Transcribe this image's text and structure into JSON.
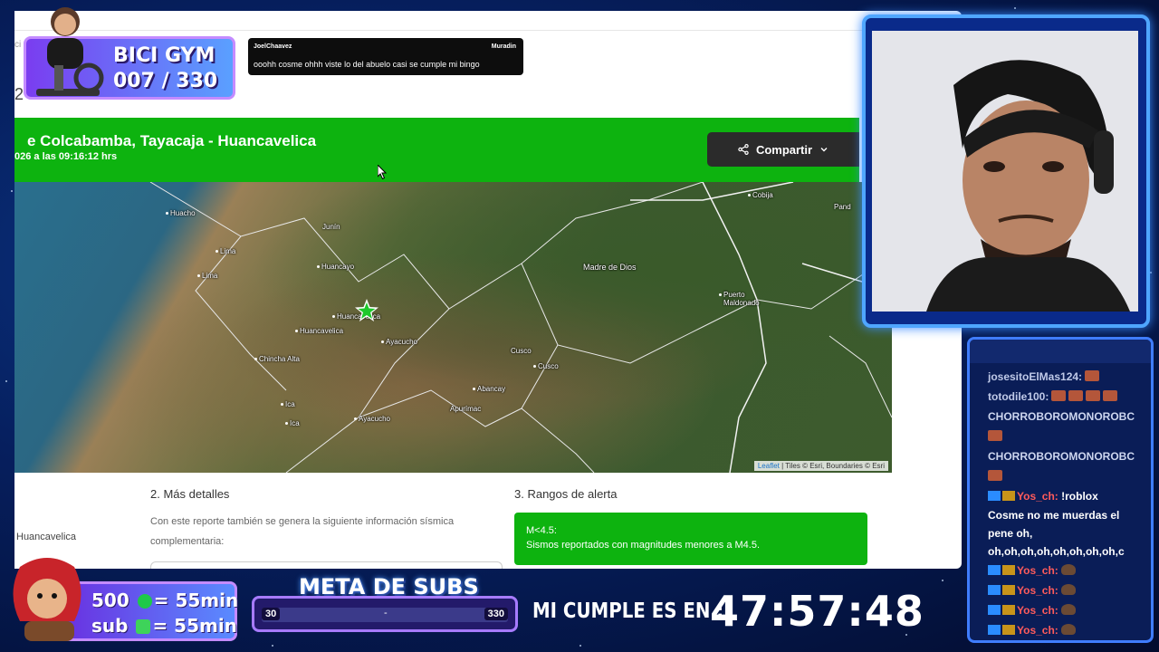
{
  "page": {
    "breadcrumb_partial": "ci",
    "section_number_partial": "2",
    "header_title": "e Colcabamba, Tayacaja - Huancavelica",
    "header_subtitle": "026 a las 09:16:12 hrs",
    "share_label": "Compartir",
    "map": {
      "labels": {
        "huacho": "Huacho",
        "lima1": "Lima",
        "lima2": "Lima",
        "junin": "Junín",
        "huancayo": "Huancayo",
        "huancavelica1": "Huancavelica",
        "huancavelica2": "Huancavelica",
        "chincha": "Chincha Alta",
        "ica1": "Ica",
        "ica2": "Ica",
        "ayacucho1": "Ayacucho",
        "ayacucho2": "Ayacucho",
        "madre": "Madre de Dios",
        "puerto": "Puerto Maldonado",
        "cusco1": "Cusco",
        "cusco2": "Cusco",
        "abancay": "Abancay",
        "apurimac": "Apurímac",
        "cobija": "Cobija",
        "pando": "Pand"
      },
      "attribution_link": "Leaflet",
      "attribution_rest": " | Tiles © Esri, Boundaries © Esri"
    },
    "details_title": "2. Más detalles",
    "details_text": "Con este reporte también se genera la siguiente información sísmica complementaria:",
    "side_location": "Huancavelica",
    "ranges_title": "3. Rangos de alerta",
    "alert_label": "M<4.5:",
    "alert_text": "Sismos reportados con magnitudes menores a M4.5."
  },
  "notification": {
    "user": "JoelChaavez",
    "platform": "Muradin",
    "message": "ooohh cosme ohhh viste lo del abuelo casi se cumple mi bingo"
  },
  "bici": {
    "title": "BICI GYM",
    "count": "007 / 330"
  },
  "chat": {
    "messages": [
      {
        "user": "josesitoElMas124:",
        "text": ""
      },
      {
        "user": "totodile100:",
        "text": ""
      },
      {
        "user": "CHORROBOROMONOROBC",
        "text": ""
      },
      {
        "user": "CHORROBOROMONOROBC",
        "text": ""
      },
      {
        "user": "Yos_ch:",
        "text": "!roblox"
      },
      {
        "user": "",
        "text": "Cosme no me muerdas el pene oh, oh,oh,oh,oh,oh,oh,oh,oh,c"
      },
      {
        "user": "Yos_ch:",
        "text": ""
      },
      {
        "user": "Yos_ch:",
        "text": ""
      },
      {
        "user": "Yos_ch:",
        "text": ""
      },
      {
        "user": "Yos_ch:",
        "text": ""
      }
    ]
  },
  "subs": {
    "line1_count": "500",
    "line1_time": "= 55min",
    "line2_label": "sub",
    "line2_time": "= 55min"
  },
  "meta": {
    "title": "META DE SUBS",
    "min": "30",
    "max": "330",
    "sep": "-",
    "progress": 0.0
  },
  "birthday": {
    "label": "MI CUMPLE ES EN :",
    "timer": "47:57:48"
  }
}
